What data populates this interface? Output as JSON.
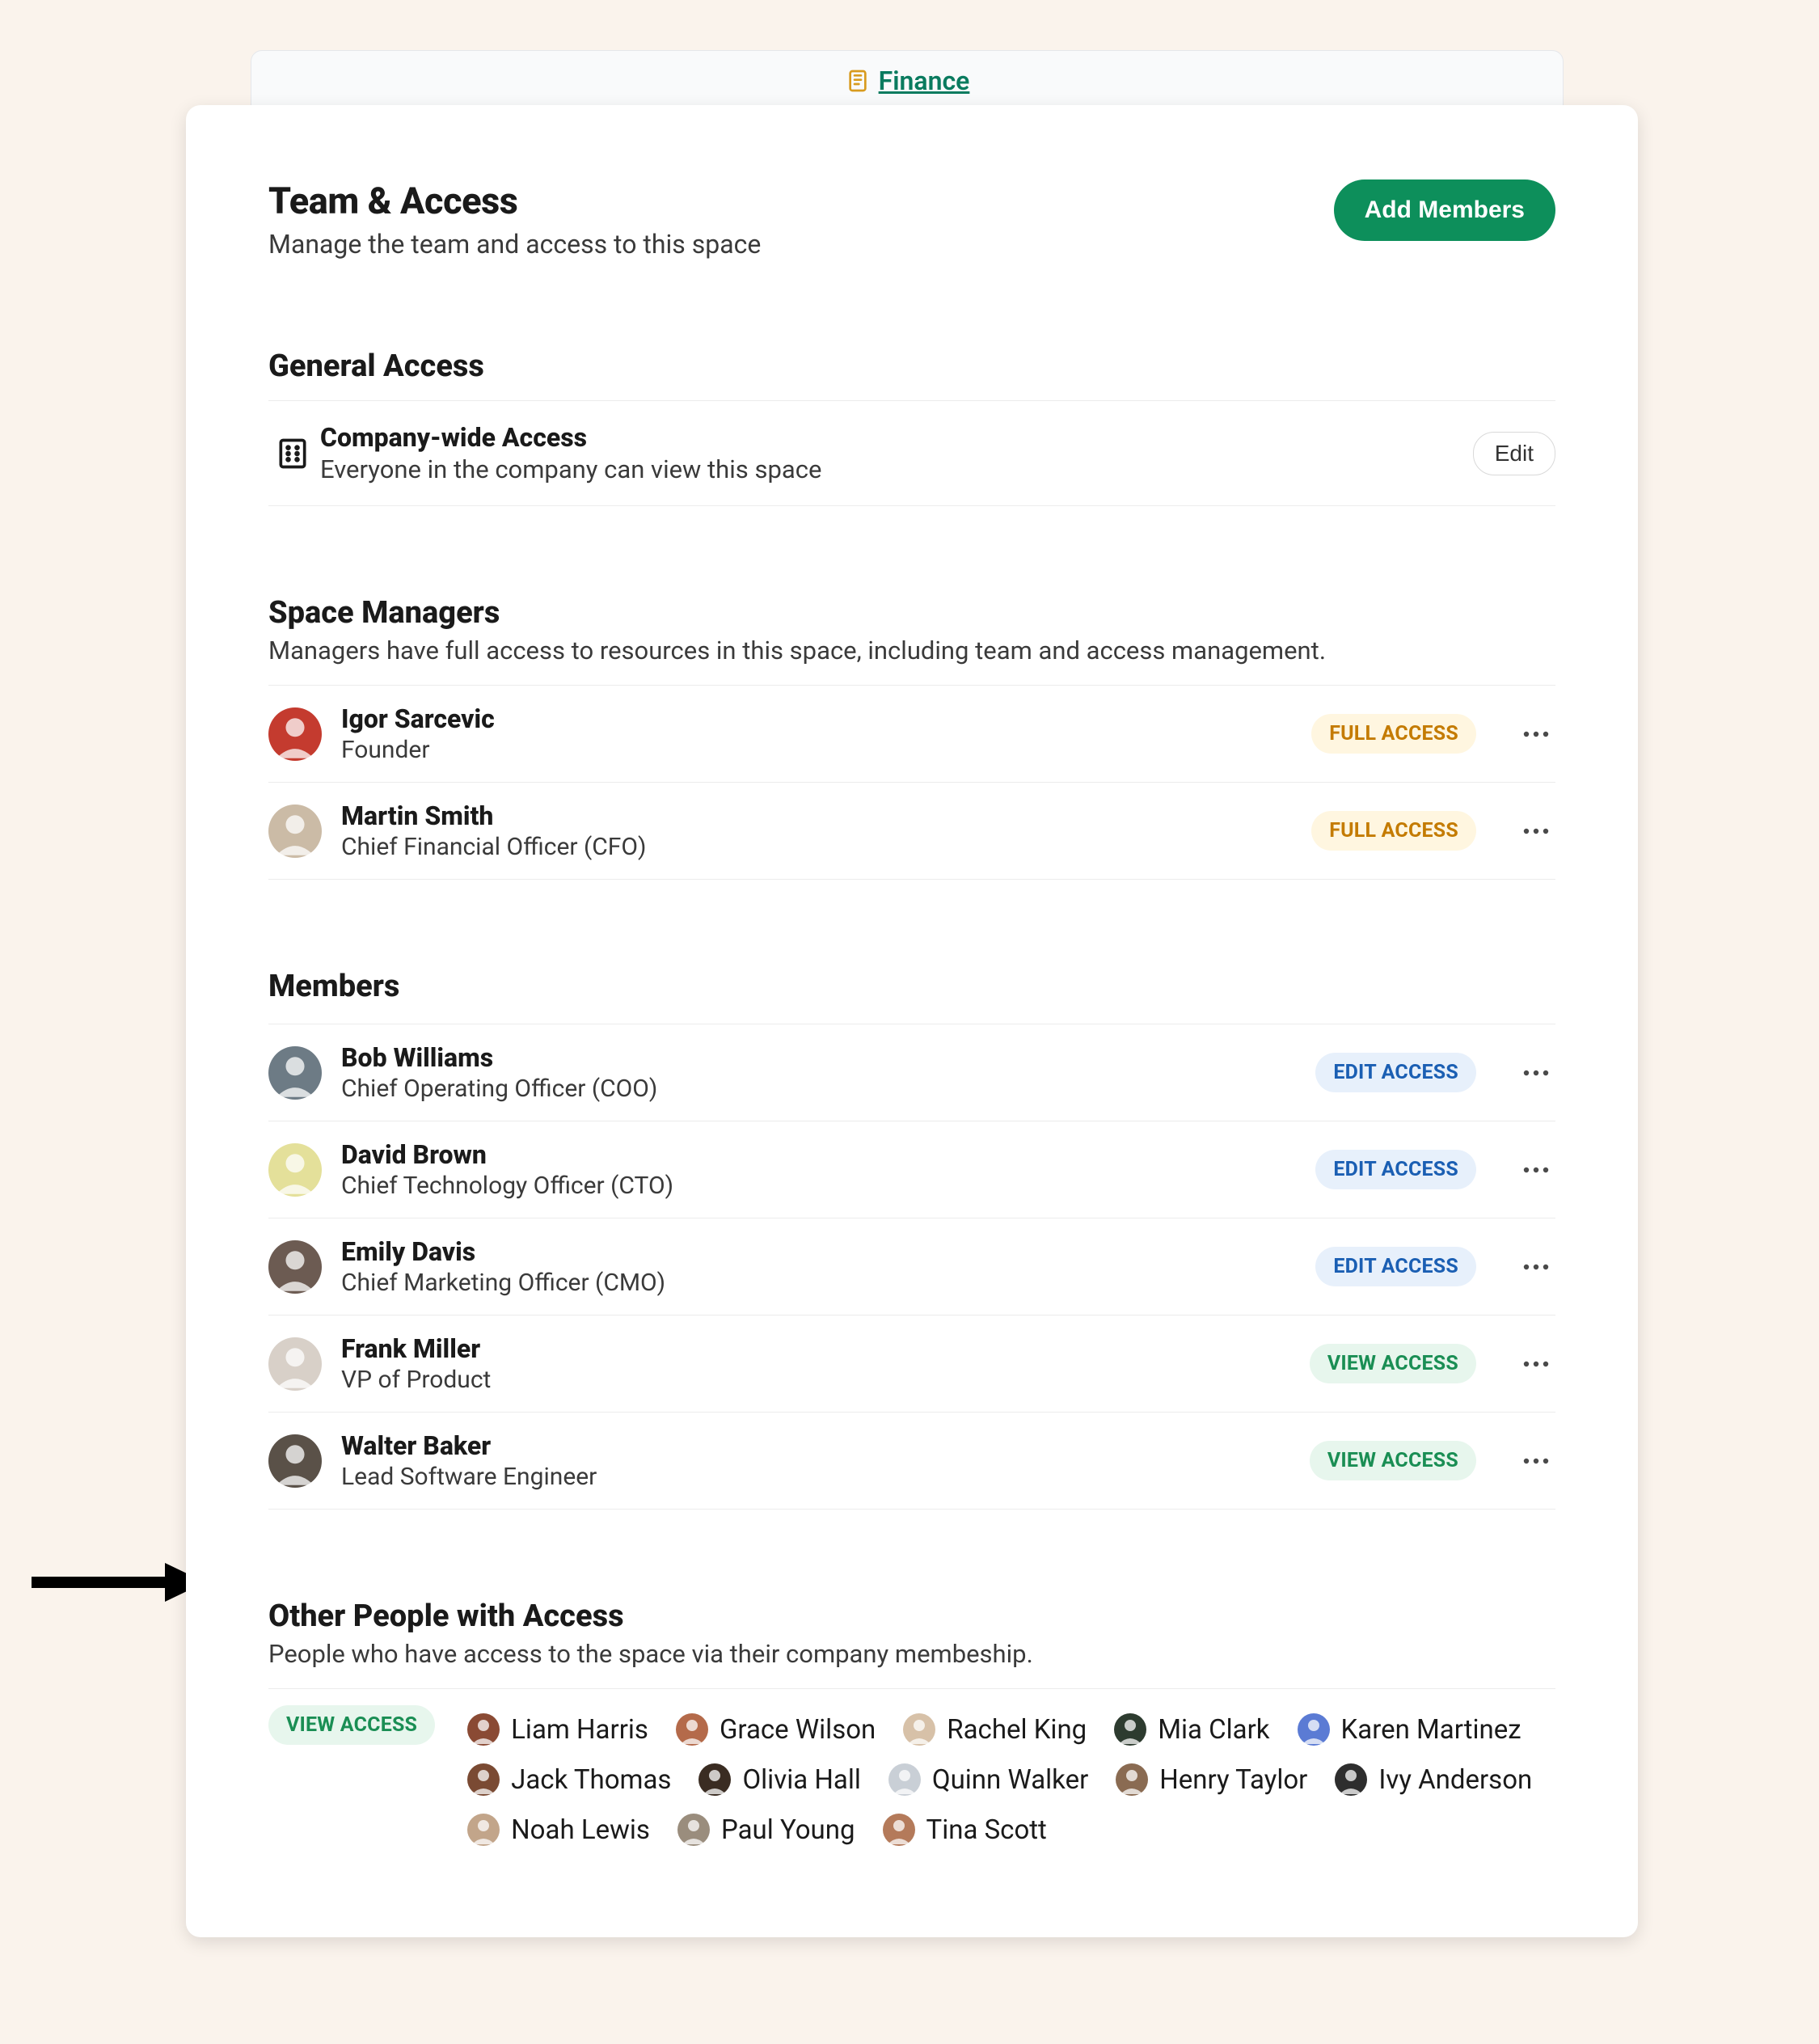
{
  "breadcrumb": {
    "label": "Finance"
  },
  "header": {
    "title": "Team & Access",
    "subtitle": "Manage the team and access to this space",
    "add_button": "Add Members"
  },
  "general": {
    "section_title": "General Access",
    "title": "Company-wide Access",
    "subtitle": "Everyone in the company can view this space",
    "edit_label": "Edit"
  },
  "managers": {
    "section_title": "Space Managers",
    "section_sub": "Managers have full access to resources in this space, including team and access management.",
    "list": [
      {
        "name": "Igor Sarcevic",
        "role": "Founder",
        "badge": "FULL ACCESS",
        "avatar": "#c43b2f"
      },
      {
        "name": "Martin Smith",
        "role": "Chief Financial Officer (CFO)",
        "badge": "FULL ACCESS",
        "avatar": "#cbbba6"
      }
    ]
  },
  "members": {
    "section_title": "Members",
    "list": [
      {
        "name": "Bob Williams",
        "role": "Chief Operating Officer (COO)",
        "badge": "EDIT ACCESS",
        "avatar": "#6d7b85"
      },
      {
        "name": "David Brown",
        "role": "Chief Technology Officer (CTO)",
        "badge": "EDIT ACCESS",
        "avatar": "#e4e09a"
      },
      {
        "name": "Emily Davis",
        "role": "Chief Marketing Officer (CMO)",
        "badge": "EDIT ACCESS",
        "avatar": "#6c5b52"
      },
      {
        "name": "Frank Miller",
        "role": "VP of Product",
        "badge": "VIEW ACCESS",
        "avatar": "#d8d0c8"
      },
      {
        "name": "Walter Baker",
        "role": "Lead Software Engineer",
        "badge": "VIEW ACCESS",
        "avatar": "#5a5148"
      }
    ]
  },
  "others": {
    "section_title": "Other People with Access",
    "section_sub": "People who have access to the space via their company membeship.",
    "badge": "VIEW ACCESS",
    "people": [
      {
        "name": "Liam Harris",
        "avatar": "#8a4a34"
      },
      {
        "name": "Grace Wilson",
        "avatar": "#b46a4a"
      },
      {
        "name": "Rachel King",
        "avatar": "#d7c1a8"
      },
      {
        "name": "Mia Clark",
        "avatar": "#2d3b2f"
      },
      {
        "name": "Karen Martinez",
        "avatar": "#5b7bd4"
      },
      {
        "name": "Jack Thomas",
        "avatar": "#7a4a33"
      },
      {
        "name": "Olivia Hall",
        "avatar": "#3a2c22"
      },
      {
        "name": "Quinn Walker",
        "avatar": "#c9cfd6"
      },
      {
        "name": "Henry Taylor",
        "avatar": "#8a6b52"
      },
      {
        "name": "Ivy Anderson",
        "avatar": "#2e2e2e"
      },
      {
        "name": "Noah Lewis",
        "avatar": "#c2a58a"
      },
      {
        "name": "Paul Young",
        "avatar": "#9a8d7d"
      },
      {
        "name": "Tina Scott",
        "avatar": "#b47a5a"
      }
    ]
  }
}
